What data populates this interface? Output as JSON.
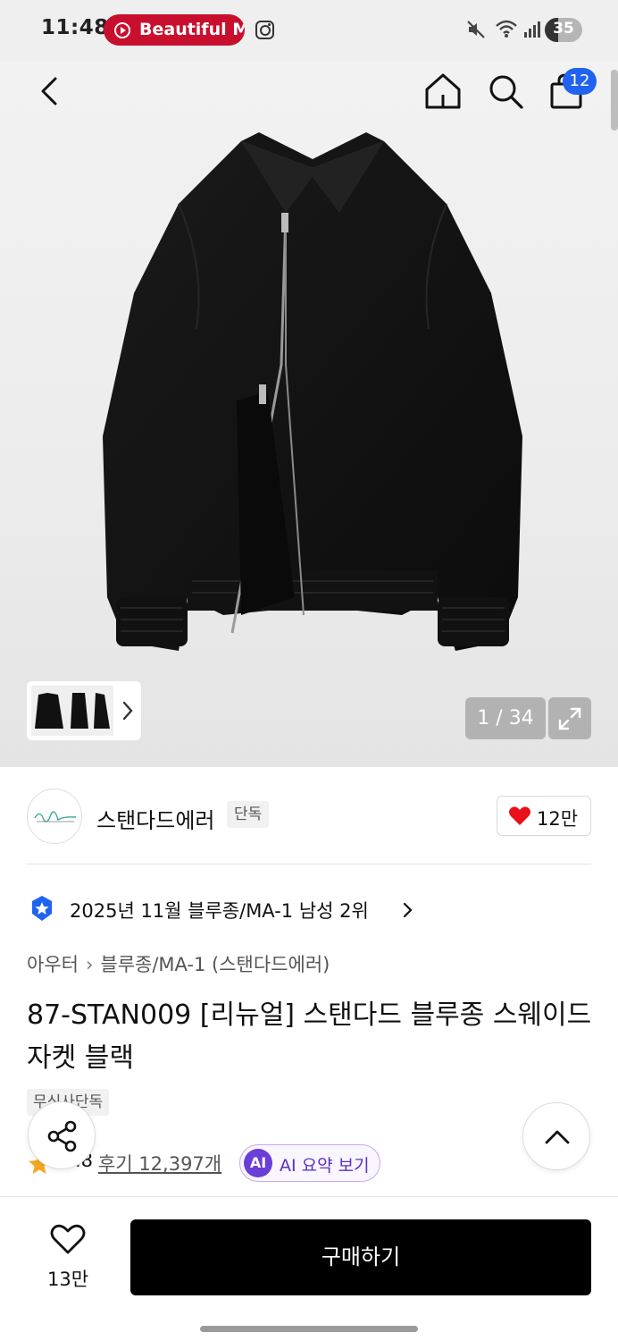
{
  "status_bar": {
    "time": "11:48",
    "media_pill": "Beautiful M",
    "battery_percent": "35",
    "battery_level": 0.35,
    "icons": [
      "youtube-music-icon",
      "instagram-icon",
      "mute-icon",
      "wifi-icon",
      "signal-icon",
      "battery-icon"
    ]
  },
  "header": {
    "icons": [
      "back-icon",
      "home-icon",
      "search-icon",
      "shopping-bag-icon"
    ],
    "cart_count": "12"
  },
  "gallery": {
    "counter": "1 / 34",
    "icons": [
      "chevron-right-icon",
      "expand-icon"
    ]
  },
  "brand": {
    "name": "스탠다드에러",
    "tag": "단독",
    "likes": "12만"
  },
  "ranking": {
    "text": "2025년 11월 블루종/MA-1 남성 2위"
  },
  "breadcrumb": {
    "category": "아우터",
    "subcategory": "블루종/MA-1 (스탠다드에러)"
  },
  "product": {
    "title": "87-STAN009 [리뉴얼] 스탠다드 블루종 스웨이드 자켓 블랙",
    "exclusive_tag": "무신사단독",
    "rating_partial": ".8",
    "reviews": "후기 12,397개",
    "ai_badge": "AI",
    "ai_label": "AI 요약 보기"
  },
  "bottom_bar": {
    "wish_count": "13만",
    "buy_label": "구매하기"
  },
  "colors": {
    "brand_red": "#c8102e",
    "badge_blue": "#1f63f0",
    "ai_purple": "#6a3ed8",
    "buy_black": "#000000",
    "heart_red": "#e8101b"
  }
}
